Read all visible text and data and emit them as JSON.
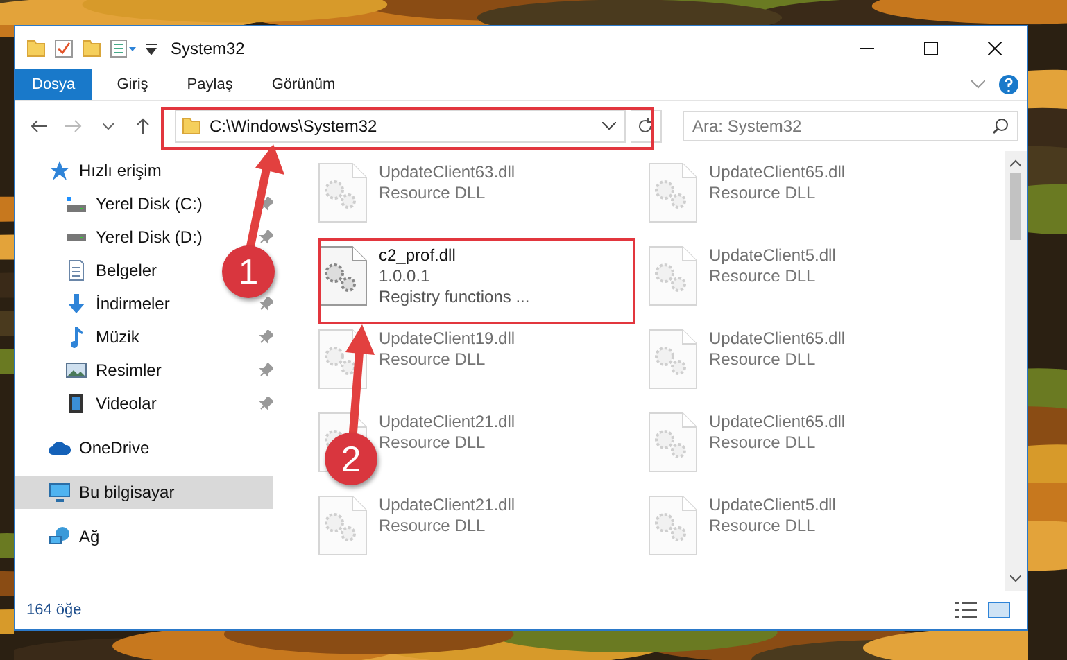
{
  "window": {
    "title": "System32"
  },
  "ribbon_tabs": [
    {
      "label": "Dosya",
      "kind": "file"
    },
    {
      "label": "Giriş",
      "kind": "tab"
    },
    {
      "label": "Paylaş",
      "kind": "tab"
    },
    {
      "label": "Görünüm",
      "kind": "tab"
    }
  ],
  "address": {
    "path": "C:\\Windows\\System32"
  },
  "search": {
    "placeholder": "Ara: System32"
  },
  "sidebar": {
    "items": [
      {
        "label": "Hızlı erişim",
        "kind": "star",
        "selected": false,
        "children": [
          {
            "label": "Yerel Disk (C:)",
            "kind": "drive-c",
            "pinned": true,
            "selected": false
          },
          {
            "label": "Yerel Disk (D:)",
            "kind": "drive",
            "pinned": true,
            "selected": false
          },
          {
            "label": "Belgeler",
            "kind": "docs",
            "selected": false
          },
          {
            "label": "İndirmeler",
            "kind": "download",
            "pinned": true,
            "selected": false
          },
          {
            "label": "Müzik",
            "kind": "music",
            "pinned": true,
            "selected": false
          },
          {
            "label": "Resimler",
            "kind": "pictures",
            "pinned": true,
            "selected": false
          },
          {
            "label": "Videolar",
            "kind": "videos",
            "pinned": true,
            "selected": false
          }
        ]
      },
      {
        "label": "OneDrive",
        "kind": "cloud",
        "selected": false
      },
      {
        "label": "Bu bilgisayar",
        "kind": "pc",
        "selected": true
      },
      {
        "label": "Ağ",
        "kind": "network",
        "selected": false
      }
    ]
  },
  "files": [
    {
      "name": "UpdateClient63.dll",
      "details": [
        "Resource DLL"
      ],
      "blurred": true
    },
    {
      "name": "UpdateClient65.dll",
      "details": [
        "Resource DLL"
      ],
      "blurred": true
    },
    {
      "name": "c2_prof.dll",
      "details": [
        "1.0.0.1",
        "Registry functions ..."
      ],
      "blurred": false
    },
    {
      "name": "UpdateClient5.dll",
      "details": [
        "Resource DLL"
      ],
      "blurred": true
    },
    {
      "name": "UpdateClient19.dll",
      "details": [
        "Resource DLL"
      ],
      "blurred": true
    },
    {
      "name": "UpdateClient65.dll",
      "details": [
        "Resource DLL"
      ],
      "blurred": true
    },
    {
      "name": "UpdateClient21.dll",
      "details": [
        "Resource DLL"
      ],
      "blurred": true
    },
    {
      "name": "UpdateClient65.dll",
      "details": [
        "Resource DLL"
      ],
      "blurred": true
    },
    {
      "name": "UpdateClient21.dll",
      "details": [
        "Resource DLL"
      ],
      "blurred": true
    },
    {
      "name": "UpdateClient5.dll",
      "details": [
        "Resource DLL"
      ],
      "blurred": true
    }
  ],
  "status_bar": {
    "count": "164 öğe"
  },
  "annotations": [
    {
      "label": "1"
    },
    {
      "label": "2"
    }
  ]
}
